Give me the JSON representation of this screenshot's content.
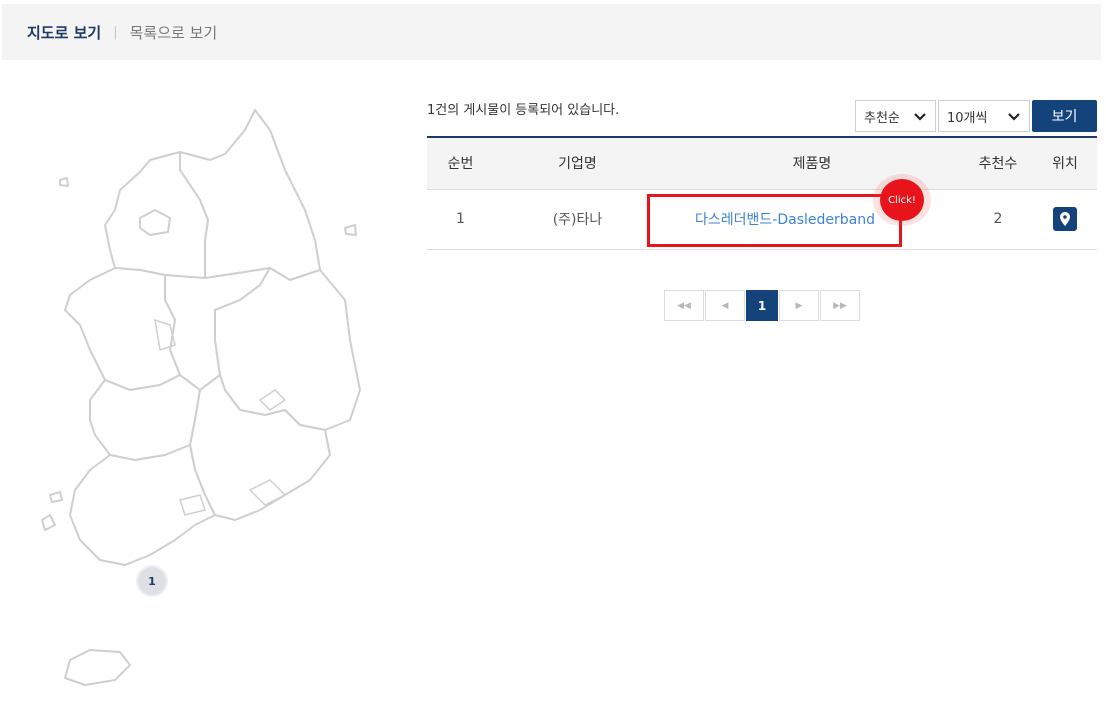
{
  "tabs": {
    "map_view": "지도로 보기",
    "separator": "|",
    "list_view": "목록으로 보기"
  },
  "map": {
    "cluster_count": "1"
  },
  "list": {
    "count_text": "1건의 게시물이 등록되어 있습니다.",
    "sort_selected": "추천순",
    "per_page_selected": "10개씩",
    "view_button": "보기"
  },
  "table": {
    "headers": {
      "no": "순번",
      "company": "기업명",
      "product": "제품명",
      "recommend": "추천수",
      "location": "위치"
    },
    "rows": [
      {
        "no": "1",
        "company": "(주)타나",
        "product": "다스레더밴드-Daslederband",
        "recommend": "2"
      }
    ]
  },
  "annotation": {
    "click_label": "Click!",
    "color": "#e8141c"
  },
  "pagination": {
    "first": "◀◀",
    "prev": "◀",
    "current": "1",
    "next": "▶",
    "last": "▶▶"
  },
  "colors": {
    "primary": "#14427a",
    "link": "#3d83d6",
    "highlight": "#e8141c"
  },
  "icons": {
    "location": "map-pin-icon",
    "dropdown": "chevron-down-icon"
  }
}
